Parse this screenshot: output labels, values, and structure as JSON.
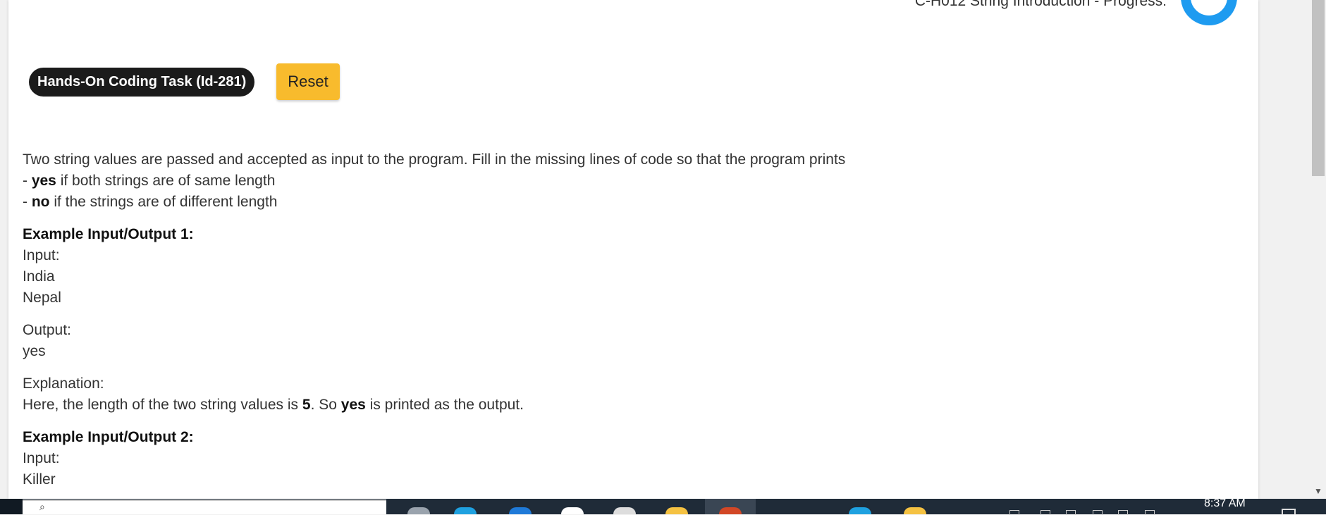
{
  "header": {
    "progress_title": "C-H012 String Introduction - Progress:"
  },
  "task": {
    "badge_label": "Hands-On Coding Task (Id-281)",
    "reset_label": "Reset"
  },
  "problem": {
    "intro": "Two string values are passed and accepted as input to the program. Fill in the missing lines of code so that the program prints",
    "rule_yes_prefix": "- ",
    "rule_yes_keyword": "yes",
    "rule_yes_text": " if both strings are of same length",
    "rule_no_prefix": "- ",
    "rule_no_keyword": "no",
    "rule_no_text": " if the strings are of different length"
  },
  "example1": {
    "heading": "Example Input/Output 1:",
    "input_label": "Input:",
    "input_line1": "India",
    "input_line2": "Nepal",
    "output_label": "Output:",
    "output_value": "yes",
    "explanation_label": "Explanation:",
    "explanation_part1": "Here, the length of the two string values is ",
    "explanation_bold1": "5",
    "explanation_part2": ". So ",
    "explanation_bold2": "yes",
    "explanation_part3": " is printed as the output."
  },
  "example2": {
    "heading": "Example Input/Output 2:",
    "input_label": "Input:",
    "input_line1": "Killer"
  },
  "taskbar": {
    "search_glyph": "⌕",
    "clock_time": "8:37 AM",
    "icons": [
      {
        "name": "task-view-icon",
        "color": "#9aa3ad"
      },
      {
        "name": "edge-browser-icon",
        "color": "#1fa1e0"
      },
      {
        "name": "mail-icon",
        "color": "#1f7ad8"
      },
      {
        "name": "dropbox-icon",
        "color": "#ffffff"
      },
      {
        "name": "chrome-icon",
        "color": "#dddddd"
      },
      {
        "name": "file-explorer-icon",
        "color": "#f5c242"
      },
      {
        "name": "powerpoint-icon",
        "color": "#d24726"
      },
      {
        "name": "network-app-icon",
        "color": "#1fa1e0"
      },
      {
        "name": "sticky-app-icon",
        "color": "#f5c242"
      }
    ]
  }
}
